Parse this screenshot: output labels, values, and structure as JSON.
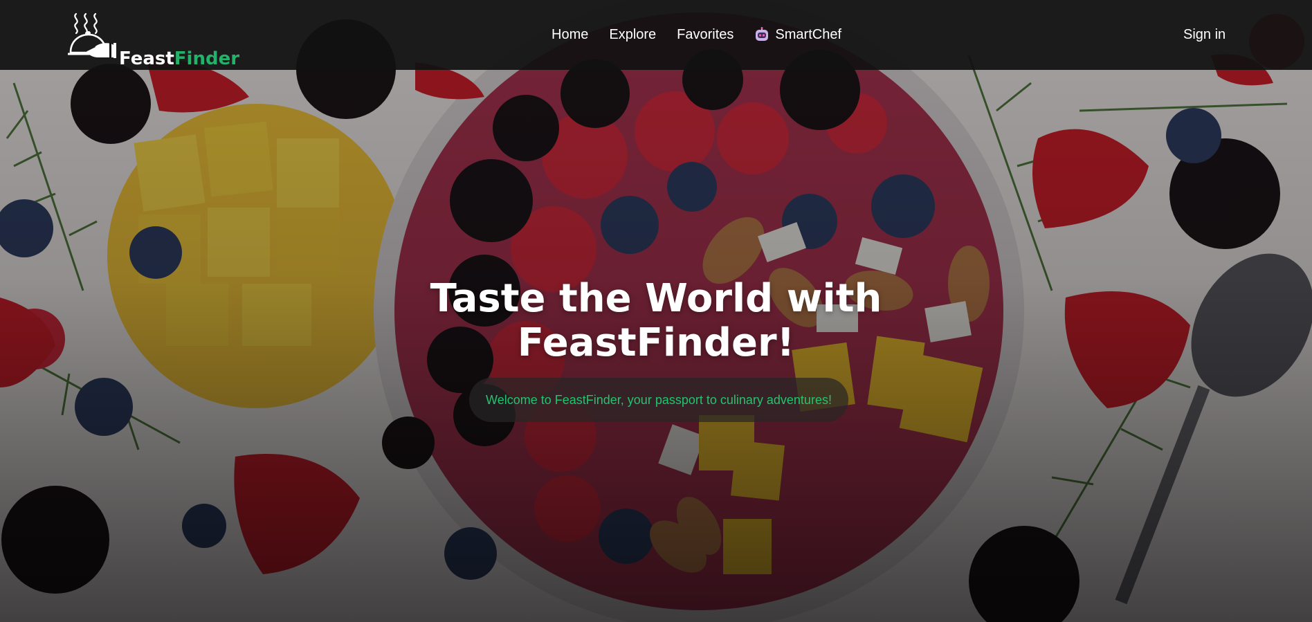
{
  "brand": {
    "name_part1": "Feast",
    "name_part2": "Finder",
    "accent_color": "#22b26a",
    "logo_icon": "food-cloche-icon"
  },
  "nav": {
    "items": [
      {
        "label": "Home"
      },
      {
        "label": "Explore"
      },
      {
        "label": "Favorites"
      },
      {
        "label": "SmartChef",
        "icon": "robot-icon"
      }
    ],
    "signin_label": "Sign in"
  },
  "hero": {
    "title": "Taste the World with FeastFinder!",
    "welcome_text": "Welcome to FeastFinder, your passport to culinary adventures!",
    "welcome_color": "#22c46d",
    "background": "smoothie-bowl-photo"
  }
}
